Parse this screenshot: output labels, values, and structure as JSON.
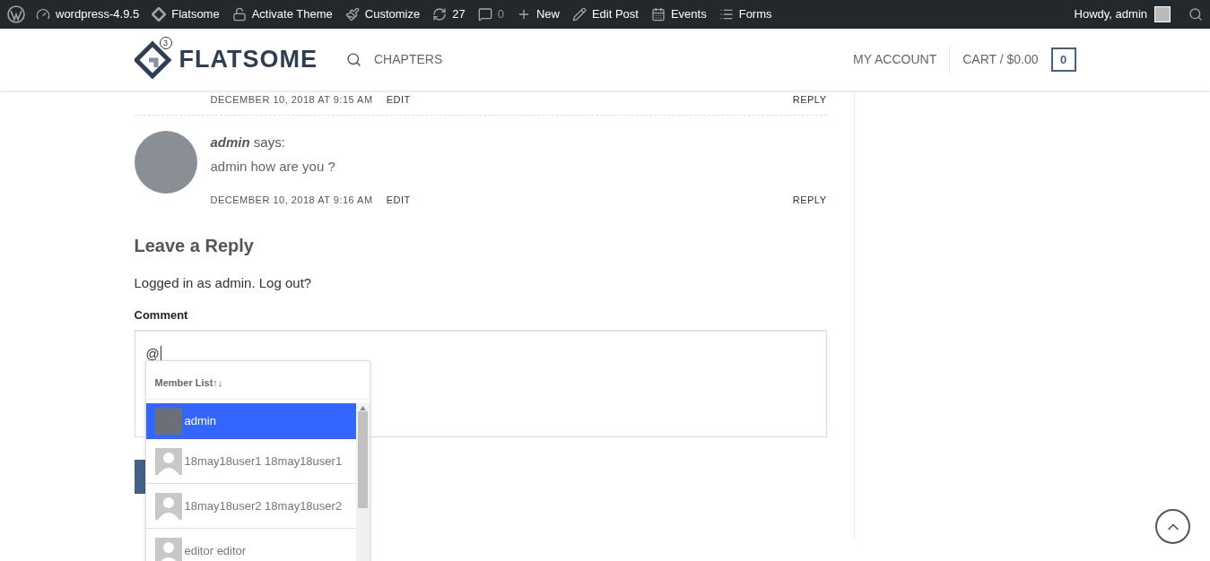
{
  "admin_bar": {
    "items": [
      {
        "label": "wordpress-4.9.5",
        "kind": "link"
      },
      {
        "label": "Flatsome",
        "kind": "link"
      },
      {
        "label": "Activate Theme",
        "kind": "link"
      },
      {
        "label": "Customize",
        "kind": "link"
      },
      {
        "label": "27",
        "kind": "count"
      },
      {
        "label": "0",
        "kind": "muted"
      },
      {
        "label": "New",
        "kind": "link"
      },
      {
        "label": "Edit Post",
        "kind": "link"
      },
      {
        "label": "Events",
        "kind": "link"
      },
      {
        "label": "Forms",
        "kind": "link"
      }
    ],
    "greeting": "Howdy, admin"
  },
  "header": {
    "logo": "FLATSOME",
    "logo_badge": "3",
    "nav": [
      "CHAPTERS"
    ],
    "account": "MY ACCOUNT",
    "cart": "CART / $0.00",
    "cart_count": "0"
  },
  "comments": [
    {
      "date": "DECEMBER 10, 2018 AT 9:15 AM",
      "edit": "EDIT",
      "reply": "REPLY"
    },
    {
      "author": "admin",
      "says": "says:",
      "text": "admin how are you ?",
      "date": "DECEMBER 10, 2018 AT 9:16 AM",
      "edit": "EDIT",
      "reply": "REPLY"
    }
  ],
  "reply_form": {
    "title": "Leave a Reply",
    "logged_in": "Logged in as admin. Log out?",
    "comment_label": "Comment",
    "comment_value": "@"
  },
  "mention_list": {
    "title": "Member List↑↓",
    "members": [
      {
        "name": "admin",
        "selected": true,
        "kind": "photo"
      },
      {
        "name": "18may18user1 18may18user1",
        "selected": false,
        "kind": "default"
      },
      {
        "name": "18may18user2 18may18user2",
        "selected": false,
        "kind": "default"
      },
      {
        "name": "editor editor",
        "selected": false,
        "kind": "default"
      }
    ]
  }
}
